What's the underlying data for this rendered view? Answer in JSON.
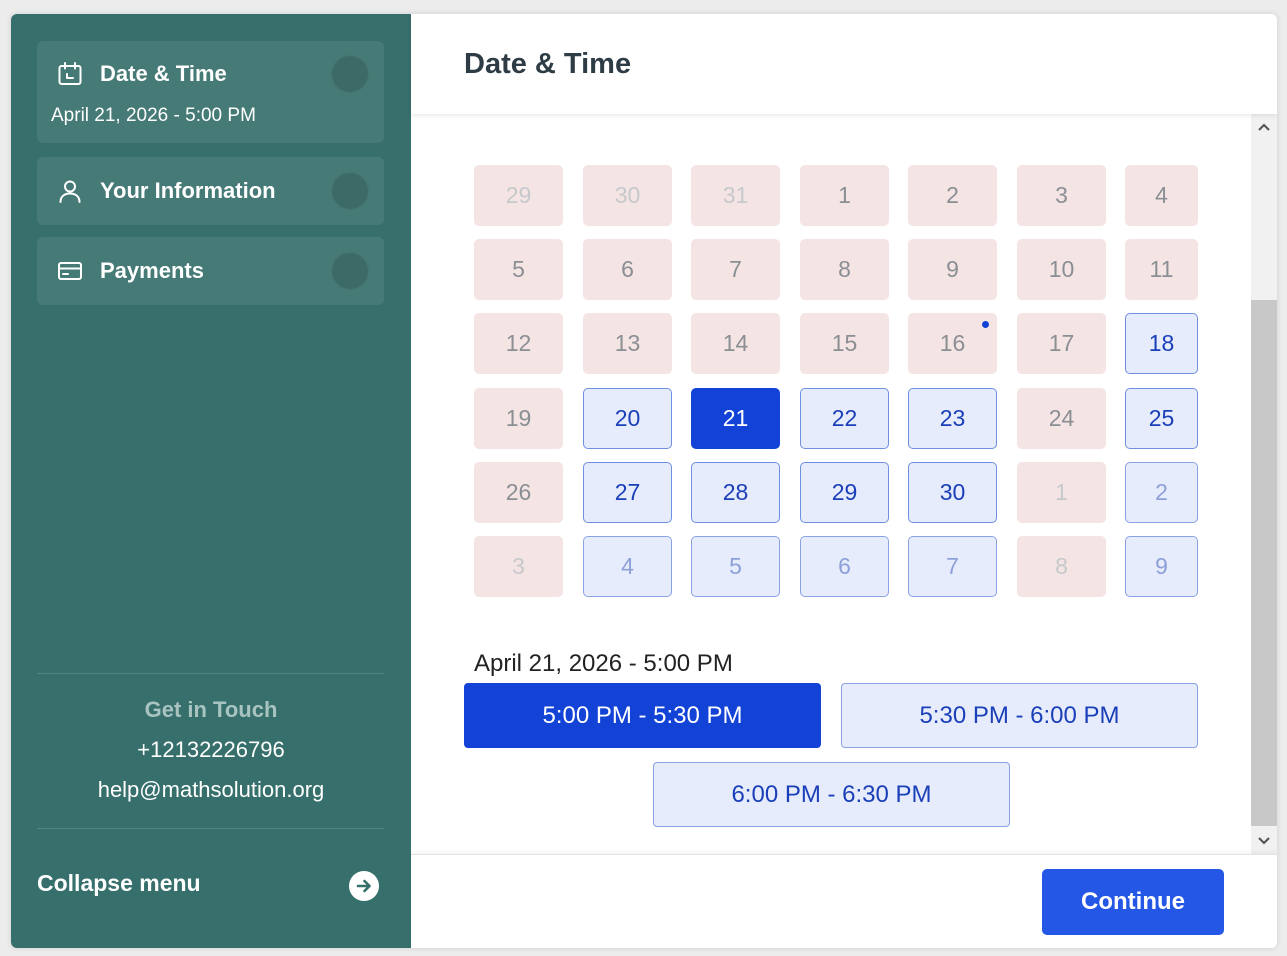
{
  "sidebar": {
    "steps": [
      {
        "label": "Date & Time",
        "sub": "April 21, 2026 - 5:00 PM",
        "icon": "calendar-icon"
      },
      {
        "label": "Your Information",
        "icon": "user-icon"
      },
      {
        "label": "Payments",
        "icon": "credit-card-icon"
      }
    ],
    "contact": {
      "title": "Get in Touch",
      "phone": "+12132226796",
      "email": "help@mathsolution.org"
    },
    "collapse_label": "Collapse menu",
    "collapse_icon": "arrow-right-circle-icon"
  },
  "header": {
    "title": "Date & Time"
  },
  "calendar": {
    "days": [
      {
        "label": "29",
        "state": "unavailable",
        "other_month": true
      },
      {
        "label": "30",
        "state": "unavailable",
        "other_month": true
      },
      {
        "label": "31",
        "state": "unavailable",
        "other_month": true
      },
      {
        "label": "1",
        "state": "unavailable"
      },
      {
        "label": "2",
        "state": "unavailable"
      },
      {
        "label": "3",
        "state": "unavailable"
      },
      {
        "label": "4",
        "state": "unavailable"
      },
      {
        "label": "5",
        "state": "unavailable"
      },
      {
        "label": "6",
        "state": "unavailable"
      },
      {
        "label": "7",
        "state": "unavailable"
      },
      {
        "label": "8",
        "state": "unavailable"
      },
      {
        "label": "9",
        "state": "unavailable"
      },
      {
        "label": "10",
        "state": "unavailable"
      },
      {
        "label": "11",
        "state": "unavailable"
      },
      {
        "label": "12",
        "state": "unavailable"
      },
      {
        "label": "13",
        "state": "unavailable"
      },
      {
        "label": "14",
        "state": "unavailable"
      },
      {
        "label": "15",
        "state": "unavailable"
      },
      {
        "label": "16",
        "state": "unavailable",
        "today": true
      },
      {
        "label": "17",
        "state": "unavailable"
      },
      {
        "label": "18",
        "state": "available"
      },
      {
        "label": "19",
        "state": "unavailable"
      },
      {
        "label": "20",
        "state": "available"
      },
      {
        "label": "21",
        "state": "selected"
      },
      {
        "label": "22",
        "state": "available"
      },
      {
        "label": "23",
        "state": "available"
      },
      {
        "label": "24",
        "state": "unavailable"
      },
      {
        "label": "25",
        "state": "available"
      },
      {
        "label": "26",
        "state": "unavailable"
      },
      {
        "label": "27",
        "state": "available"
      },
      {
        "label": "28",
        "state": "available"
      },
      {
        "label": "29",
        "state": "available"
      },
      {
        "label": "30",
        "state": "available"
      },
      {
        "label": "1",
        "state": "unavailable",
        "other_month": true
      },
      {
        "label": "2",
        "state": "available",
        "other_month": true
      },
      {
        "label": "3",
        "state": "unavailable",
        "other_month": true
      },
      {
        "label": "4",
        "state": "available",
        "other_month": true
      },
      {
        "label": "5",
        "state": "available",
        "other_month": true
      },
      {
        "label": "6",
        "state": "available",
        "other_month": true
      },
      {
        "label": "7",
        "state": "available",
        "other_month": true
      },
      {
        "label": "8",
        "state": "unavailable",
        "other_month": true
      },
      {
        "label": "9",
        "state": "available",
        "other_month": true
      }
    ]
  },
  "selected_datetime": "April 21, 2026 - 5:00 PM",
  "time_slots": [
    {
      "label": "5:00 PM - 5:30 PM",
      "active": true
    },
    {
      "label": "5:30 PM - 6:00 PM",
      "active": false
    },
    {
      "label": "6:00 PM - 6:30 PM",
      "active": false
    }
  ],
  "footer": {
    "continue_label": "Continue"
  },
  "colors": {
    "sidebar_bg": "#366f6b",
    "accent": "#1243d6",
    "button": "#2557e6",
    "unavailable_bg": "#f5e4e4",
    "available_bg": "#e6ecfb"
  }
}
